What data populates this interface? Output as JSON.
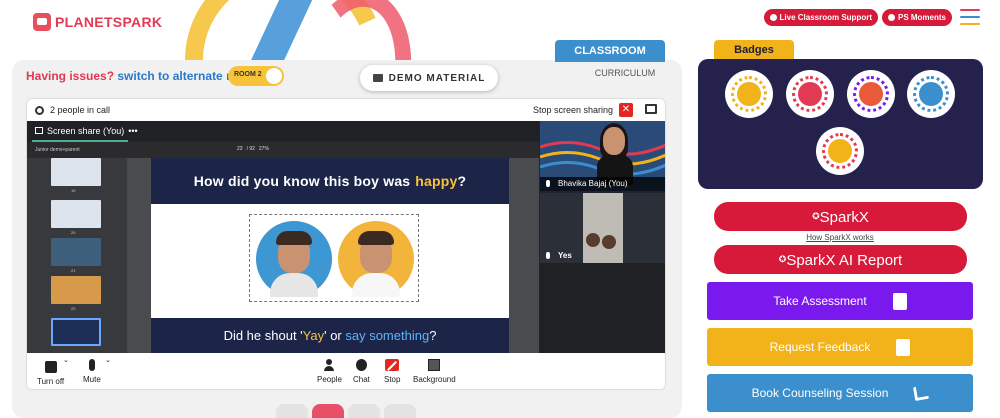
{
  "brand": {
    "logo_text": "PLANETSPARK"
  },
  "header": {
    "live_support": "Live Classroom Support",
    "ps_moments": "PS Moments",
    "menu_colors": [
      "#e23a52",
      "#3b8fcc",
      "#f2b21a"
    ]
  },
  "classroom": {
    "issue_prefix": "Having issues?",
    "issue_link": "switch to alternate room",
    "room_toggle": "ROOM 2",
    "demo_material": "DEMO MATERIAL",
    "tab_classroom": "CLASSROOM",
    "tab_curriculum": "CURRICULUM"
  },
  "call": {
    "people_count": "2 people in call",
    "stop_sharing": "Stop screen sharing",
    "share_label": "Screen share (You)",
    "share_more": "•••",
    "pdf": {
      "doc_name": "Junior demo+parent",
      "page": "23",
      "total": "/ 92",
      "zoom": "27%"
    },
    "thumb_numbers": [
      "19",
      "20",
      "21",
      "22"
    ],
    "slide": {
      "title_prefix": "How did you know this boy was",
      "title_highlight": "happy",
      "title_suffix": "?",
      "footer_a": "Did he shout '",
      "footer_yay": "Yay",
      "footer_b": "' or ",
      "footer_say": "say something",
      "footer_c": "?"
    },
    "participants": [
      {
        "name": "Bhavika Bajaj (You)"
      },
      {
        "name": "Yes"
      }
    ],
    "controls": {
      "turn_off": "Turn off",
      "mute": "Mute",
      "people": "People",
      "chat": "Chat",
      "stop": "Stop",
      "background": "Background"
    }
  },
  "badges": {
    "title": "Badges",
    "colors": [
      "#f2b21a",
      "#e23a52",
      "#7a19ed",
      "#3b8fcc",
      "#e23a52"
    ]
  },
  "actions": {
    "sparkx": "SparkX",
    "how_sparkx": "How SparkX works",
    "sparkx_ai": "SparkX AI Report",
    "take_assessment": "Take Assessment",
    "request_feedback": "Request Feedback",
    "book_counseling": "Book Counseling Session"
  }
}
